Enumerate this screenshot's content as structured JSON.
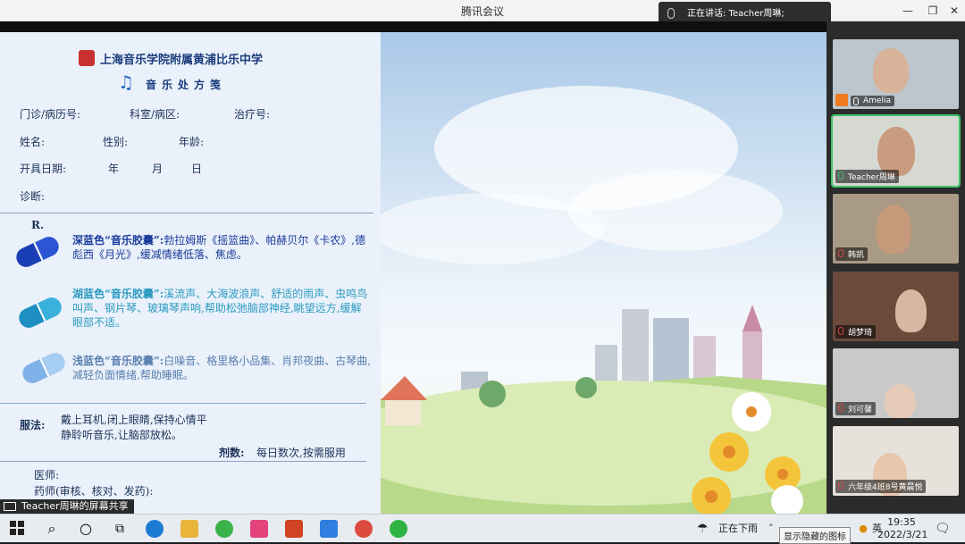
{
  "window": {
    "title": "腾讯会议",
    "speaking_banner": "正在讲话: Teacher周琳;"
  },
  "slide": {
    "school_name": "上海音乐学院附属黄浦比乐中学",
    "rx_title": "音乐处方笺",
    "fields": {
      "clinic_no": "门诊/病历号:",
      "department": "科室/病区:",
      "treatment_no": "治疗号:",
      "name": "姓名:",
      "gender": "性别:",
      "age": "年龄:",
      "date": "开具日期:",
      "year": "年",
      "month": "月",
      "day": "日",
      "diagnosis": "诊断:",
      "rx": "R."
    },
    "capsules": [
      {
        "title": "深蓝色“音乐胶囊”:",
        "text": "勃拉姆斯《摇篮曲》、帕赫贝尔《卡农》,德彪西《月光》,缓减情绪低落、焦虑。",
        "color_dark": "#1a3fb5",
        "color_light": "#2c55d4",
        "text_color": "#1a3a9a"
      },
      {
        "title": "湖蓝色“音乐胶囊”:",
        "text": "溪流声、大海波浪声、舒适的雨声、虫鸣鸟叫声、钢片琴、玻璃琴声响,帮助松弛脑部神经,眺望远方,缓解眼部不适。",
        "color_dark": "#1d8fc1",
        "color_light": "#3ab0dd",
        "text_color": "#2a9ac0"
      },
      {
        "title": "浅蓝色“音乐胶囊”:",
        "text": "白噪音、格里格小品集、肖邦夜曲、古琴曲,减轻负面情绪,帮助睡眠。",
        "color_dark": "#7fb2e8",
        "color_light": "#a6cdf2",
        "text_color": "#5a7fae"
      }
    ],
    "usage_label": "服法:",
    "usage_line1": "戴上耳机,闭上眼睛,保持心情平",
    "usage_line2": "静聆听音乐,让脑部放松。",
    "dosage_label": "剂数:",
    "dosage_text": "每日数次,按需服用",
    "doctor_label": "医师:",
    "pharmacist_label": "药师(审核、核对、发药):"
  },
  "participants": [
    {
      "name": "Amelia",
      "badge": true
    },
    {
      "name": "Teacher周琳",
      "active": true
    },
    {
      "name": "韩凯"
    },
    {
      "name": "胡梦琦"
    },
    {
      "name": "刘可馨"
    },
    {
      "name": "六年级4班8号黄晨悦"
    }
  ],
  "share_caption": "Teacher周琳的屏幕共享",
  "taskbar": {
    "weather": "正在下雨",
    "ime": "英",
    "time": "19:35",
    "date": "2022/3/21",
    "tooltip": "显示隐藏的图标"
  }
}
